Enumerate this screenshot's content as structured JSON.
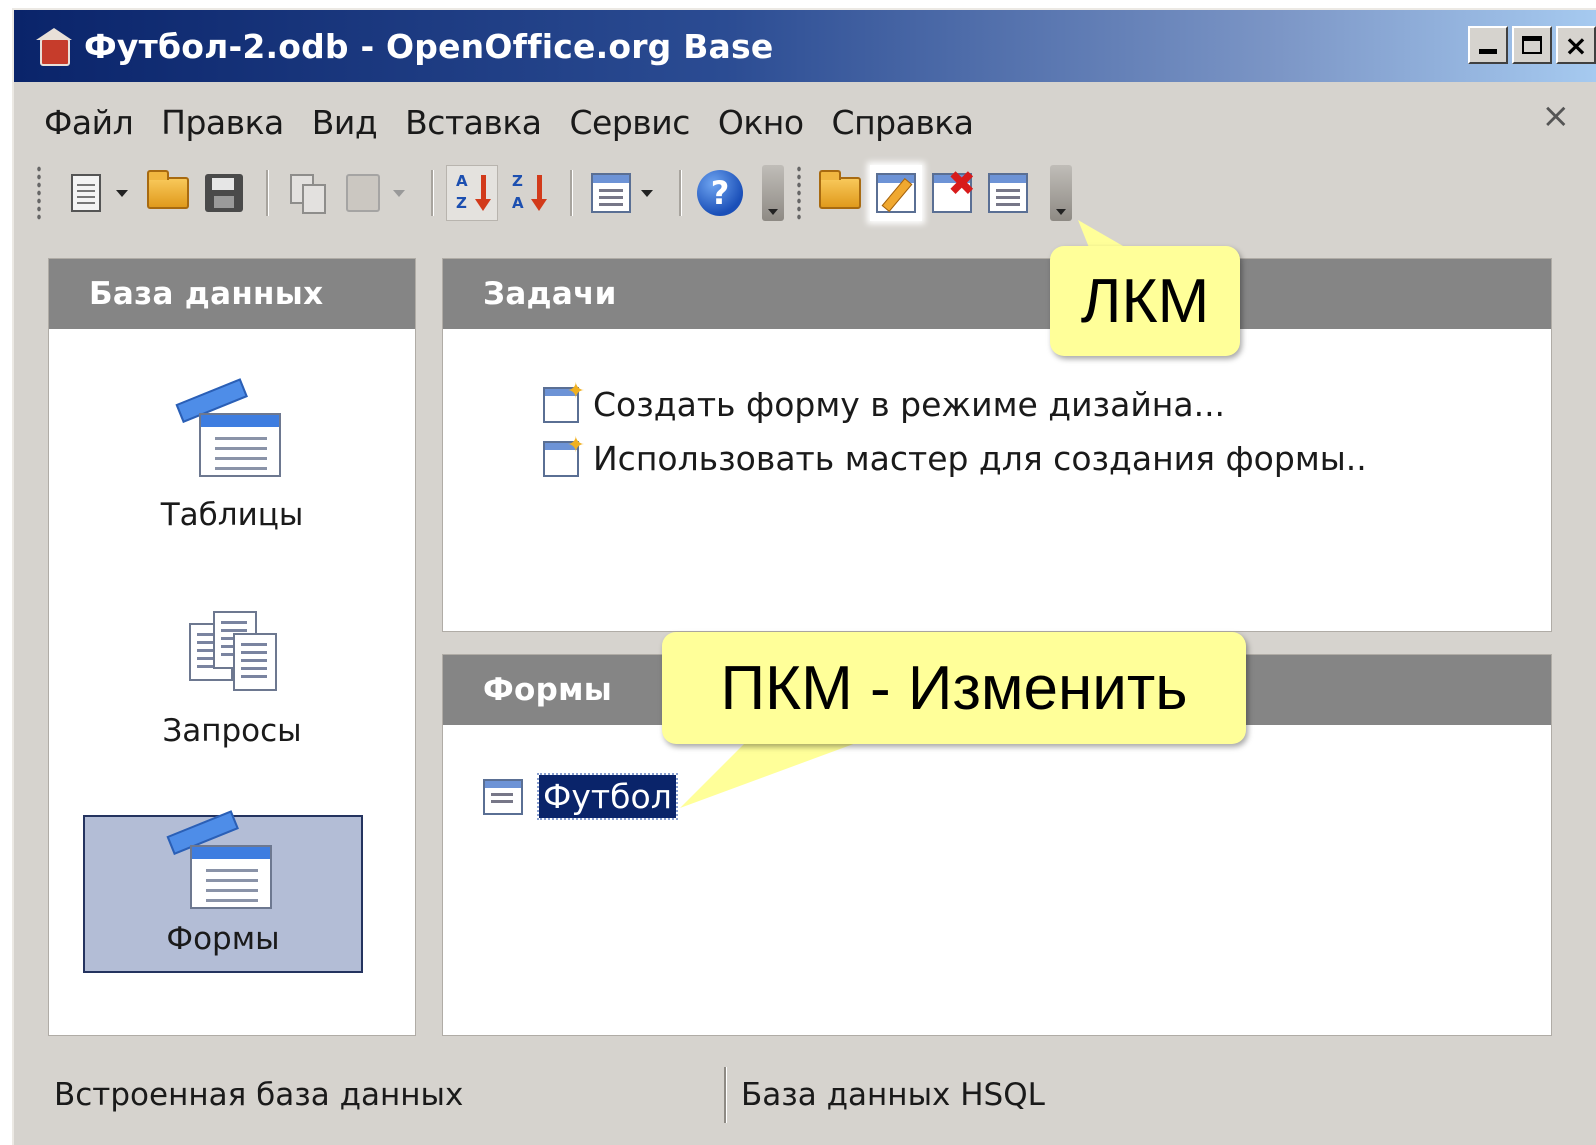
{
  "window": {
    "title": "Футбол-2.odb - OpenOffice.org Base",
    "minimize": "_",
    "close": "×"
  },
  "menu": {
    "items": [
      "Файл",
      "Правка",
      "Вид",
      "Вставка",
      "Сервис",
      "Окно",
      "Справка"
    ],
    "close": "×"
  },
  "toolbar": {
    "help_glyph": "?",
    "sort_asc": {
      "top": "A",
      "bottom": "Z"
    },
    "sort_desc": {
      "top": "Z",
      "bottom": "A"
    },
    "delete_glyph": "✖"
  },
  "sidebar": {
    "heading": "База данных",
    "items": [
      {
        "label": "Таблицы",
        "icon": "tables-icon"
      },
      {
        "label": "Запросы",
        "icon": "queries-icon"
      },
      {
        "label": "Формы",
        "icon": "forms-icon",
        "selected": true
      }
    ]
  },
  "tasks": {
    "heading": "Задачи",
    "items": [
      {
        "label": "Создать форму в режиме дизайна...",
        "icon": "new-form-design-icon"
      },
      {
        "label": "Использовать мастер для создания формы..",
        "icon": "form-wizard-icon"
      }
    ]
  },
  "forms": {
    "heading": "Формы",
    "items": [
      {
        "label": "Футбол",
        "selected": true
      }
    ]
  },
  "status": {
    "left": "Встроенная база данных",
    "right": "База данных HSQL"
  },
  "callouts": {
    "left_click": "ЛКМ",
    "right_click": "ПКМ - Изменить"
  },
  "colors": {
    "callout_fill": "#ffff99",
    "title_bar": "#0a246a",
    "panel_header": "#858585",
    "selection": "#0a246a"
  }
}
